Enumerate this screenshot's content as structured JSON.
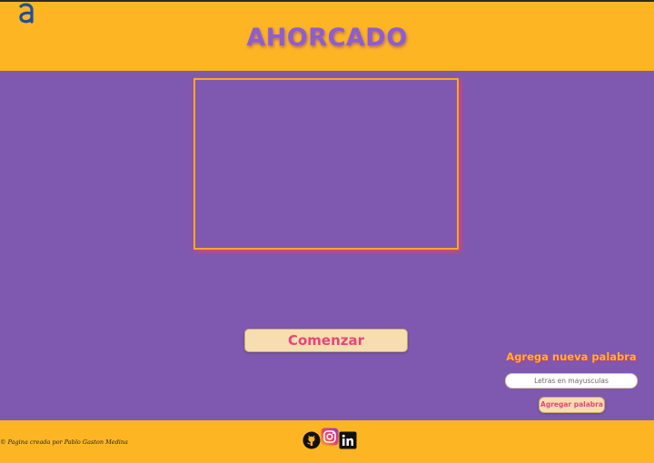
{
  "header": {
    "title": "AHORCADO",
    "logo_glyph": "a",
    "logo_icon": "alura-logo-icon",
    "bg_color": "#fdb524",
    "title_color": "#8c5ed0"
  },
  "game": {
    "canvas_border_color": "#f9a825",
    "start_label": "Comenzar"
  },
  "add_word": {
    "title": "Agrega nueva palabra",
    "input_placeholder": "Letras en mayusculas",
    "input_value": "",
    "button_label": "Agregar palabra"
  },
  "footer": {
    "copyright": "© Pagina creada por Pablo Gaston Medina",
    "social_icons": [
      "github-icon",
      "instagram-icon",
      "linkedin-icon"
    ]
  },
  "colors": {
    "background": "#7f59b0",
    "accent_pink": "#e8457a",
    "button_bg": "#f6deb0"
  }
}
